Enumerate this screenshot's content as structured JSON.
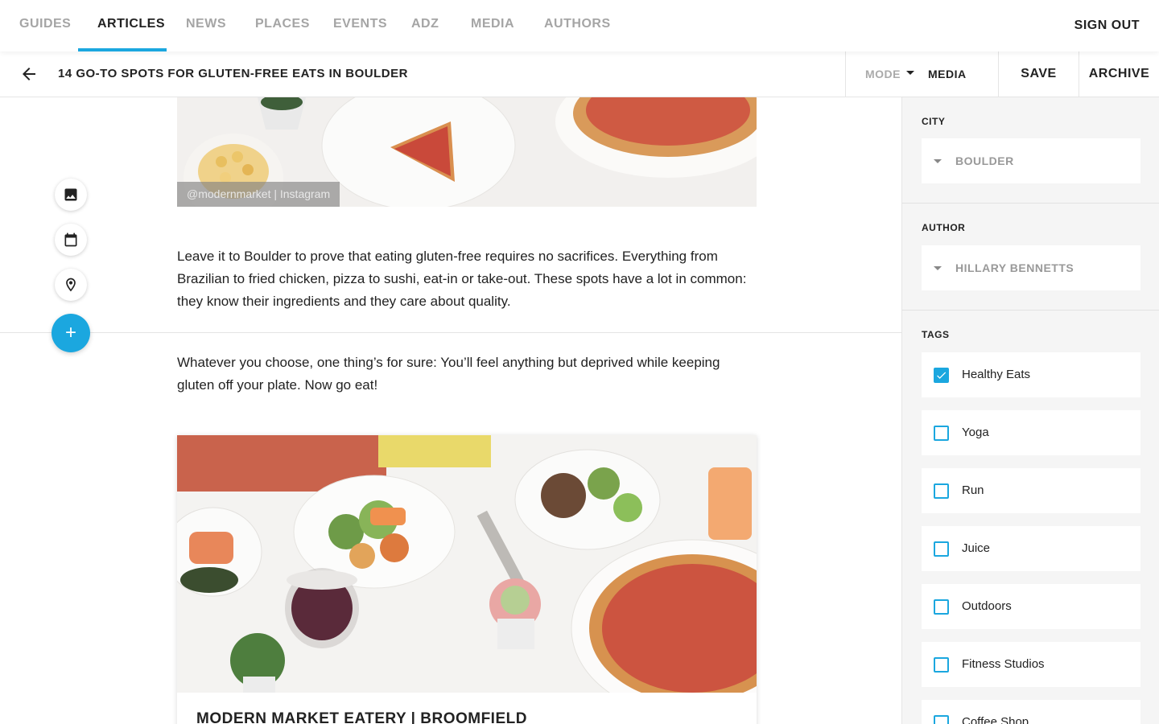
{
  "nav": {
    "items": [
      "GUIDES",
      "ARTICLES",
      "NEWS",
      "PLACES",
      "EVENTS",
      "ADZ",
      "MEDIA",
      "AUTHORS"
    ],
    "active": "ARTICLES",
    "sign_out": "SIGN OUT"
  },
  "toolbar": {
    "article_title": "14 GO-TO SPOTS FOR GLUTEN-FREE EATS IN BOULDER",
    "mode_label": "MODE",
    "mode_value": "MEDIA",
    "save": "SAVE",
    "archive": "ARCHIVE"
  },
  "editor": {
    "top_image_caption": "@modernmarket | Instagram",
    "paragraph_1": "Leave it to Boulder to prove that eating gluten-free requires no sacrifices. Everything from Brazilian to fried chicken, pizza to sushi, eat-in or take-out. These spots have a lot in common: they know their ingredients and they care about quality.",
    "paragraph_2": "Whatever you choose, one thing’s for sure: You’ll feel anything but deprived while keeping gluten off your plate. Now go eat!",
    "card_title": "MODERN MARKET EATERY | BROOMFIELD",
    "add_button": "+"
  },
  "sidebar": {
    "city": {
      "label": "CITY",
      "value": "BOULDER"
    },
    "author": {
      "label": "AUTHOR",
      "value": "HILLARY BENNETTS"
    },
    "tags": {
      "label": "TAGS",
      "items": [
        {
          "label": "Healthy Eats",
          "checked": true
        },
        {
          "label": "Yoga",
          "checked": false
        },
        {
          "label": "Run",
          "checked": false
        },
        {
          "label": "Juice",
          "checked": false
        },
        {
          "label": "Outdoors",
          "checked": false
        },
        {
          "label": "Fitness Studios",
          "checked": false
        },
        {
          "label": "Coffee Shop",
          "checked": false
        }
      ]
    }
  },
  "colors": {
    "accent": "#1ba7df",
    "text": "#222222",
    "muted": "#a5a5a5",
    "sidebar_bg": "#f5f5f5"
  },
  "icons": [
    "arrow-left-icon",
    "image-icon",
    "calendar-icon",
    "location-pin-icon",
    "plus-icon",
    "caret-down-icon",
    "check-icon"
  ]
}
